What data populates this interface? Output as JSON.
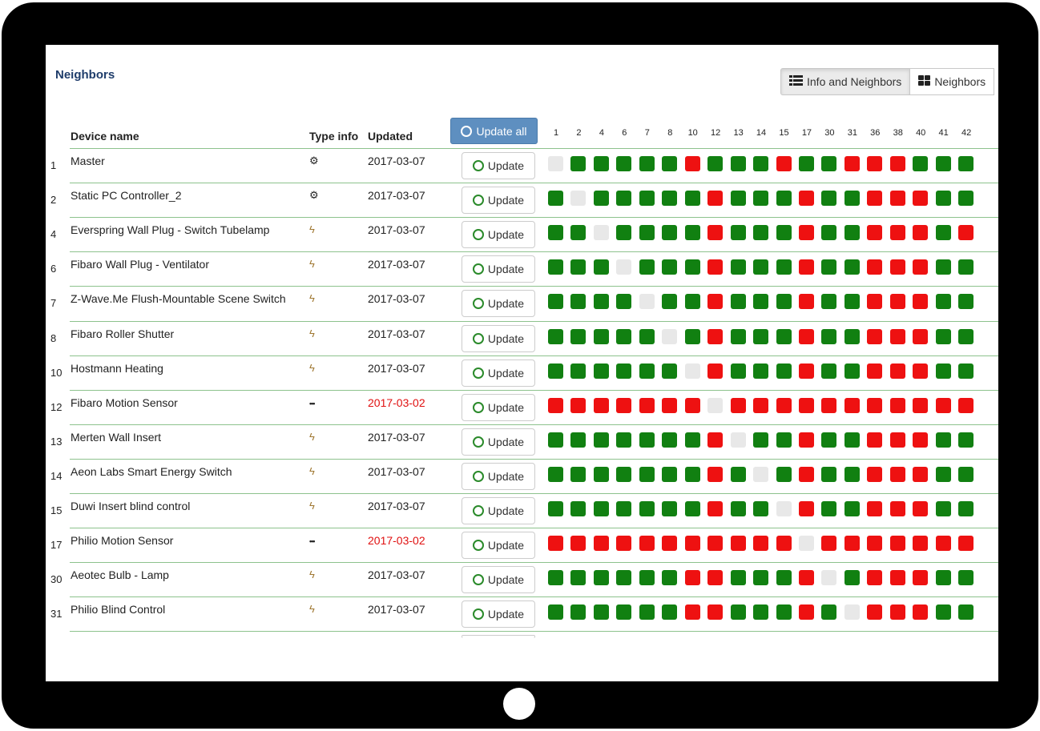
{
  "title": "Neighbors",
  "view_buttons": [
    {
      "label": "Info and Neighbors",
      "icon": "list-icon",
      "active": true
    },
    {
      "label": "Neighbors",
      "icon": "grid-icon",
      "active": false
    }
  ],
  "table": {
    "headers": {
      "device": "Device name",
      "type": "Type info",
      "updated": "Updated"
    },
    "update_all_label": "Update all",
    "update_label": "Update",
    "columns": [
      "1",
      "2",
      "4",
      "6",
      "7",
      "8",
      "10",
      "12",
      "13",
      "14",
      "15",
      "17",
      "30",
      "31",
      "36",
      "38",
      "40",
      "41",
      "42"
    ],
    "rows": [
      {
        "num": "1",
        "name": "Master",
        "type": "gear",
        "date": "2017-03-07",
        "stale": false,
        "cells": "ngggggrgggrggrrrgg"
      },
      {
        "num": "2",
        "name": "Static PC Controller_2",
        "type": "gear",
        "date": "2017-03-07",
        "stale": false,
        "cells": "gngggggrgggrggrrrgg"
      },
      {
        "num": "4",
        "name": "Everspring Wall Plug - Switch Tubelamp",
        "type": "bolt",
        "date": "2017-03-07",
        "stale": false,
        "cells": "ggnggggrgggrggrrrgr"
      },
      {
        "num": "6",
        "name": "Fibaro Wall Plug - Ventilator",
        "type": "bolt",
        "date": "2017-03-07",
        "stale": false,
        "cells": "gggngggrgggrggrrrgg"
      },
      {
        "num": "7",
        "name": "Z-Wave.Me Flush-Mountable Scene Switch",
        "type": "bolt",
        "date": "2017-03-07",
        "stale": false,
        "cells": "ggggnggrgggrggrrrgg"
      },
      {
        "num": "8",
        "name": "Fibaro Roller Shutter",
        "type": "bolt",
        "date": "2017-03-07",
        "stale": false,
        "cells": "gggggngrgggrggrrrgg"
      },
      {
        "num": "10",
        "name": "Hostmann Heating",
        "type": "bolt",
        "date": "2017-03-07",
        "stale": false,
        "cells": "ggggggnrgggrggrrrgg"
      },
      {
        "num": "12",
        "name": "Fibaro Motion Sensor",
        "type": "dots",
        "date": "2017-03-02",
        "stale": true,
        "cells": "rrrrrrrnrrrrrrrrrrr"
      },
      {
        "num": "13",
        "name": "Merten Wall Insert",
        "type": "bolt",
        "date": "2017-03-07",
        "stale": false,
        "cells": "gggggggrnggrggrrrgg"
      },
      {
        "num": "14",
        "name": "Aeon Labs Smart Energy Switch",
        "type": "bolt",
        "date": "2017-03-07",
        "stale": false,
        "cells": "gggggggrgngrggrrrgg"
      },
      {
        "num": "15",
        "name": "Duwi Insert blind control",
        "type": "bolt",
        "date": "2017-03-07",
        "stale": false,
        "cells": "gggggggrggnrggrrrgg"
      },
      {
        "num": "17",
        "name": "Philio Motion Sensor",
        "type": "dots",
        "date": "2017-03-02",
        "stale": true,
        "cells": "rrrrrrrrrrrnrrrrrrr"
      },
      {
        "num": "30",
        "name": "Aeotec Bulb - Lamp",
        "type": "bolt",
        "date": "2017-03-07",
        "stale": false,
        "cells": "ggggggrrgggrngrrrgg"
      },
      {
        "num": "31",
        "name": "Philio Blind Control",
        "type": "bolt",
        "date": "2017-03-07",
        "stale": false,
        "cells": "ggggggrrgggrgnrrrgg"
      }
    ]
  },
  "colors": {
    "ok": "#118011",
    "fail": "#ee1111",
    "self": "#e8e8e8",
    "stale_date": "#e01010",
    "accent": "#5e8fc0"
  }
}
